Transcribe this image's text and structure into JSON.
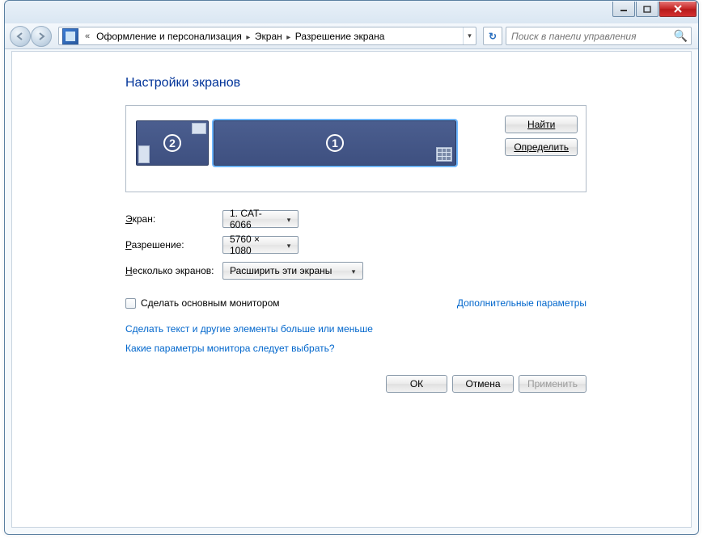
{
  "breadcrumb": {
    "seg1": "Оформление и персонализация",
    "seg2": "Экран",
    "seg3": "Разрешение экрана"
  },
  "search": {
    "placeholder": "Поиск в панели управления"
  },
  "heading": "Настройки экранов",
  "monitors": {
    "primary_num": "1",
    "secondary_num": "2"
  },
  "side_buttons": {
    "find": "Найти",
    "identify": "Определить"
  },
  "form": {
    "display_label_pre": "Э",
    "display_label_rest": "кран:",
    "display_value": "1. CAT-6066",
    "resolution_label_pre": "Р",
    "resolution_label_rest": "азрешение:",
    "resolution_value": "5760 × 1080",
    "multi_label_pre": "Н",
    "multi_label_rest": "есколько экранов:",
    "multi_value": "Расширить эти экраны"
  },
  "checkbox": {
    "label": "Сделать основным монитором"
  },
  "links": {
    "advanced": "Дополнительные параметры",
    "text_size": "Сделать текст и другие элементы больше или меньше",
    "which_params": "Какие параметры монитора следует выбрать?"
  },
  "buttons": {
    "ok": "ОК",
    "cancel": "Отмена",
    "apply": "Применить"
  }
}
